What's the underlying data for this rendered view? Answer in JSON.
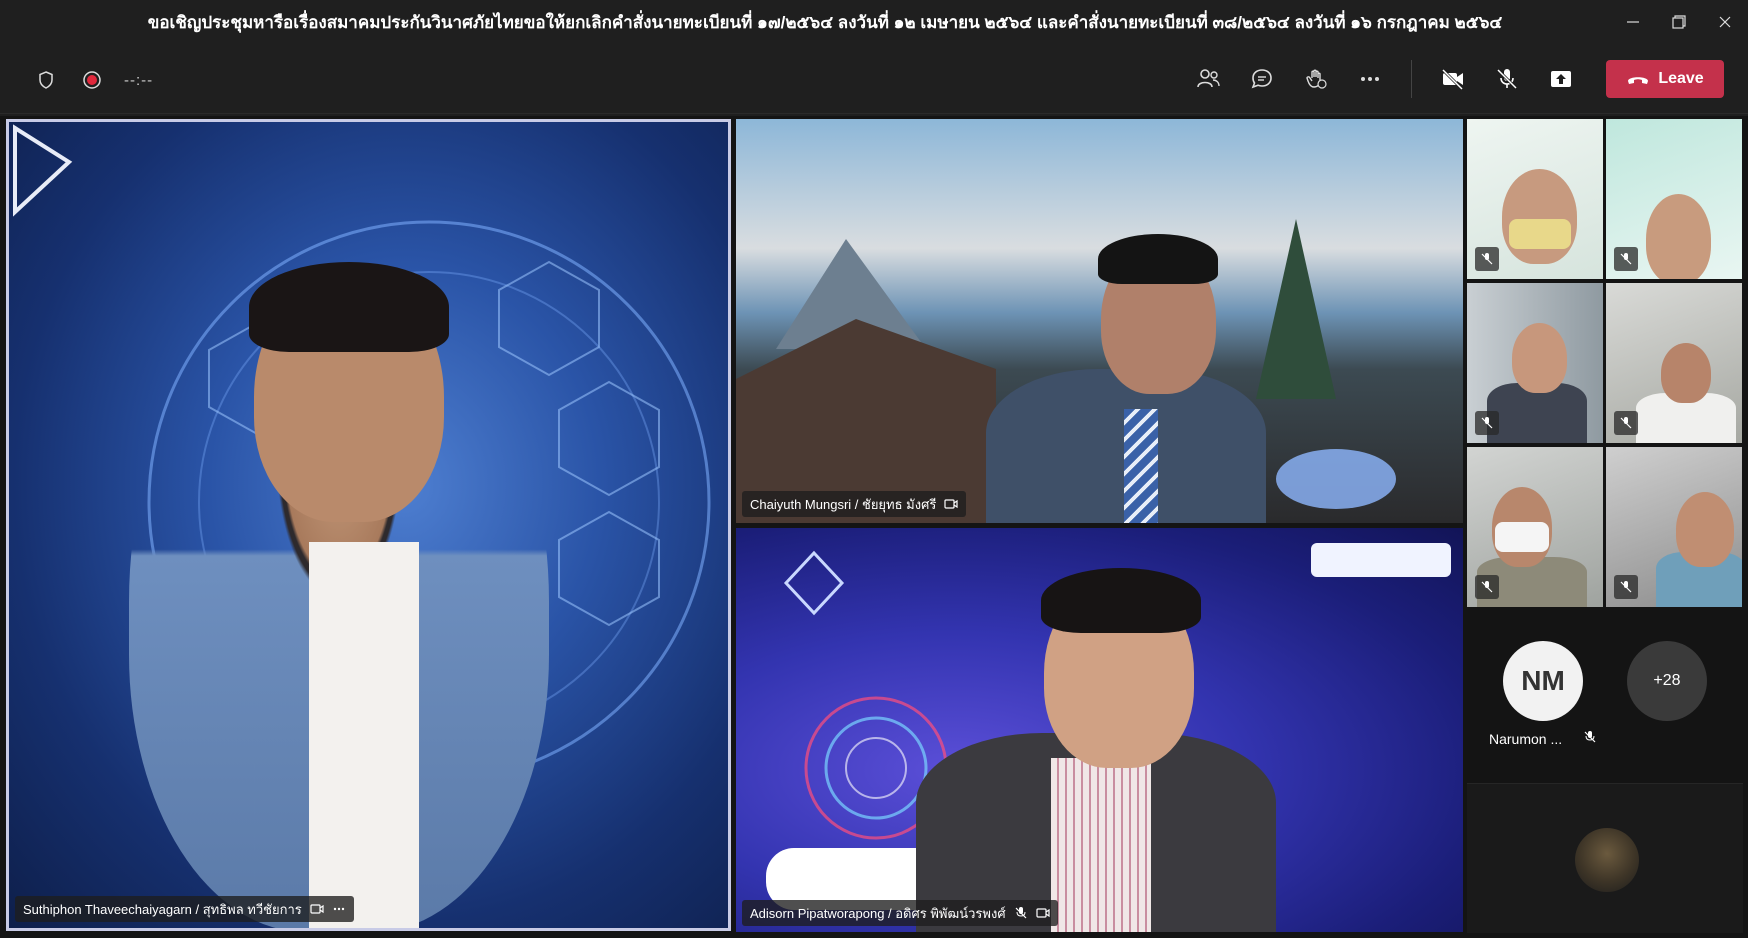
{
  "window": {
    "title": "ขอเชิญประชุมหารือเรื่องสมาคมประกันวินาศภัยไทยขอให้ยกเลิกคำสั่งนายทะเบียนที่ ๑๗/๒๕๖๔ ลงวันที่ ๑๒ เมษายน ๒๕๖๔ และคำสั่งนายทะเบียนที่ ๓๘/๒๕๖๔ ลงวันที่ ๑๖ กรกฎาคม ๒๕๖๔"
  },
  "toolbar": {
    "timer": "--:--",
    "leave_label": "Leave",
    "icons": [
      "shield-icon",
      "record-icon",
      "participants-icon",
      "chat-icon",
      "reactions-icon",
      "more-icon",
      "camera-off-icon",
      "mic-off-icon",
      "share-icon",
      "phone-hangup-icon"
    ]
  },
  "participants": {
    "speaker": {
      "name": "Suthiphon Thaveechaiyagarn / สุทธิพล ทวีชัยการ"
    },
    "top_right": {
      "name": "Chaiyuth Mungsri / ชัยยุทธ มังศรี"
    },
    "bottom_right": {
      "name": "Adisorn Pipatworapong / อดิศร พิพัฒน์วรพงศ์"
    },
    "avatar_initials": "NM",
    "avatar_name": "Narumon ...",
    "overflow_count": "+28"
  },
  "colors": {
    "leave": "#c4314b",
    "background": "#1f1f1f",
    "active_speaker_border": "#c8cbe6"
  }
}
